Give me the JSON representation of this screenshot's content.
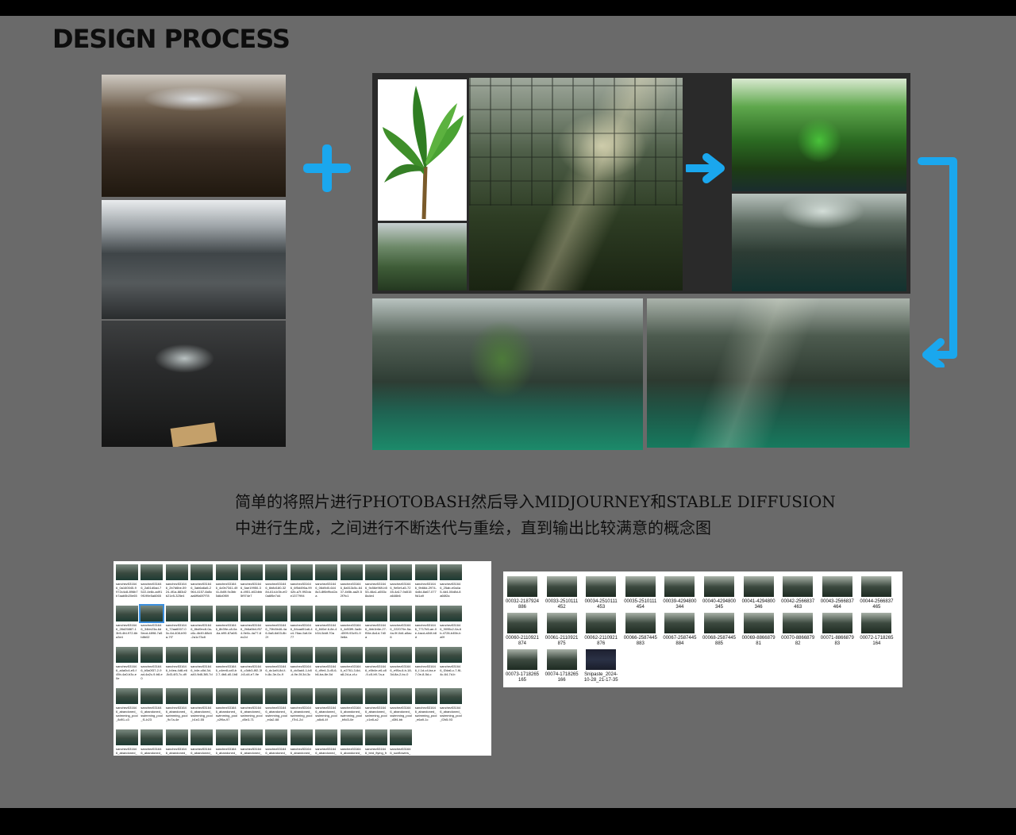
{
  "title": "DESIGN PROCESS",
  "caption": {
    "line1": "简单的将照片进行PHOTOBASH然后导入MIDJOURNEY和STABLE DIFFUSION",
    "line2": "中进行生成，之间进行不断迭代与重绘，直到输出比较满意的概念图"
  },
  "colors": {
    "accent": "#1aa7ee",
    "background": "#6a6a6a"
  },
  "icons": [
    "plus-icon",
    "arrow-right-icon",
    "bracket-arrow-icon"
  ],
  "left_browser": {
    "rows": [
      [
        "sanchez531646_0a160045-9972c4c8-896b7b7aab5b20e65",
        "sanchez531646_2a51d0ad-7522-4e8c-ad919f199e5a6065",
        "sanchez531646_2b7d6be-5924-4f1a-883d2b21e5-325e4",
        "sanchez531646_3ab6a6a5-2964-4157-8a5caa6f9a5f7f78",
        "sanchez531646_4c0b7341-4941-8d0f-9c3bb5d6d0f09",
        "sanchez531646_5ae19950-3d-4951-b02dbb5f974e7",
        "sanchez531646_6b8d180-3284-61d-b3b-ef20a6f5e7d4",
        "sanchez531646_6f5d496a-9942b-a7f-992dae1377994",
        "sanchez531646_06d9d0-6448c3-8f6bf9cd2aa",
        "sanchez531646_8a513c5c-64 07-4b5b-aa2f-52f7fc1",
        "sanchez531646_9c56e969-b553-46a1-a553c8a4e4",
        "sanchez531646_9e5ef-a5-7245-4a17-9a515a646b6",
        "sanchez531646_9b66d-2974-4c8d-8a67-0779d1a9",
        "sanchez531646_25ab-e0a4a5-4d4-00d8d-8a66f2a"
      ],
      [
        "sanchez531646_28d25887-13b5-4fd-972-6ba3e4",
        "sanchez531646_34bb23a-6d5ecd-4898-7a5b8b02",
        "sanchez531646_72aa6007-00c-6d-408-b90a-7f7",
        "sanchez531646_8bd9ec8-0a-c6c-4b49-88d4-2a1c73c8",
        "sanchez531646_8b39e-c8-0a-6a-b99-87a6f1",
        "sanchez531646_2b6a5b4-f574-9e0c-4a77-8ec2d",
        "sanchez531646_70fc5b46-4a6-0a8-6d03-8b2f",
        "sanchez531646_84cad51a6-4c4-76ac-5af-0e77",
        "sanchez531646_840cf-6-8e-4b34-5ddf-70a",
        "sanchez531646_4d53f9-3a4b-4599-93c91-90e8a",
        "sanchez531646_4bb1b6e-27-f94e-8a1d-7d0a",
        "sanchez531646_222070e-5a-4a-9f-0d4-a5ac6",
        "sanchez531646_7717b5-ae-0e-4acd-a54f-b8d",
        "sanchez531646_9095c2-0a-6b-4726-b45b-ba9f"
      ],
      [
        "sanchez531646_a4a0c4-e5-f45b-4a0-b3c-e0e",
        "sanchez531646_b5a0f37-2-9ad-4a2c-9-b8-e0",
        "sanchez531646_b4ea-4d8-e6-5d3-4f3-7c-d9",
        "sanchez531646_b4e-c8d-3d-a40-9d8-3f8-7d",
        "sanchez531646_c4ee8-cd0-b2-7-4b8-d0-1b8",
        "sanchez531646_c3db3-8f2-3f-b3-d4-e7-9e",
        "sanchez531646_dc1af4-8d-f-b-8c-3e-0c-9",
        "sanchez531646_dc5ad4-1-b8-d-9e-5f-3d-3c",
        "sanchez531646_d9e4-3-d5-6-b6-ba-8e-5d",
        "sanchez531646_e2761-3-6d-a8-2d-a-cf-c",
        "sanchez531646_e5b4e-e6-c8-9-c5-b9-7a-a",
        "sanchez531646_e95a-6-b-18-3d-8a-2-bc-0",
        "sanchez531646_f-1d-c4-ba-e7-0e-8-5d-c",
        "sanchez531646_f2da6-c-7-f6-4c-64-7d-b"
      ],
      [
        "sanchez531646_abandoned_swimming_pool_8d91-c3",
        "sanchez531646_abandoned_swimming_pool_f1-b23",
        "sanchez531646_abandoned_swimming_pool_9c7a-4e",
        "sanchez531646_abandoned_swimming_pool_b1e2-55",
        "sanchez531646_abandoned_swimming_pool_c2f9a-97",
        "sanchez531646_abandoned_swimming_pool_d5e3-71",
        "sanchez531646_abandoned_swimming_pool_e4a2-68",
        "sanchez531646_abandoned_swimming_pool_f7b1-2d",
        "sanchez531646_abandoned_swimming_pool_a8c6-4f",
        "sanchez531646_abandoned_swimming_pool_b9d3-0e",
        "sanchez531646_abandoned_swimming_pool_c1e8-a2",
        "sanchez531646_abandoned_swimming_pool_d3f4-bb",
        "sanchez531646_abandoned_swimming_pool_e6a9-1c",
        "sanchez531646_abandoned_swimming_pool_f2b5-93"
      ],
      [
        "sanchez531646_abandoned_swimming_pool_04a1",
        "sanchez531646_abandoned_swimming_pool_15b2",
        "sanchez531646_abandoned_swimming_pool_26c3",
        "sanchez531646_abandoned_swimming_pool_37d4",
        "sanchez531646_abandoned_swimming_pool_48e5",
        "sanchez531646_abandoned_swimming_pool_59f6",
        "sanchez531646_abandoned_swimming_pool_6a07",
        "sanchez531646_abandoned_swimming_pool_7b18",
        "sanchez531646_abandoned_swimming_pool_8c29",
        "sanchez531646_abandoned_swimming_pool_9d3a",
        "sanchez531646_bird_flying_from_above_a8-4",
        "sanchez531646_sunflowers_birds_and_cat_a8d-2"
      ]
    ]
  },
  "right_browser": {
    "rows": [
      [
        "00032-2187924886",
        "00033-2510111452",
        "00034-2510111453",
        "00035-2510111454",
        "00039-4294800344",
        "00040-4294800345",
        "00041-4294800346",
        "00042-2566837463",
        "00043-2566837464",
        "00044-2566837465"
      ],
      [
        "00060-2110921874",
        "00061-2110921875",
        "00062-2110921876",
        "00066-2587445883",
        "00067-2587445884",
        "00068-2587445885",
        "00069-886687981",
        "00070-886687982",
        "00071-886687983",
        "00072-1718265164"
      ],
      [
        "00073-1718265165",
        "00074-1718265166",
        "Snipaste_2024-10-28_21-17-35"
      ]
    ]
  }
}
